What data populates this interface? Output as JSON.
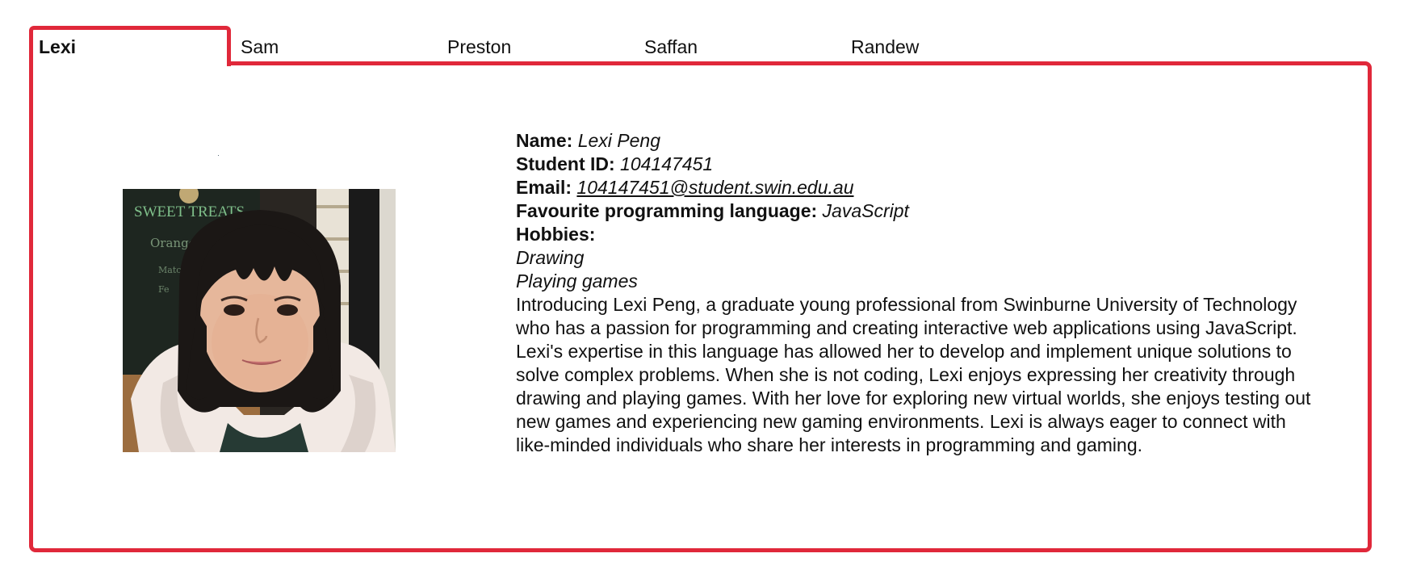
{
  "tabs": [
    {
      "label": "Lexi",
      "active": true
    },
    {
      "label": "Sam",
      "active": false
    },
    {
      "label": "Preston",
      "active": false
    },
    {
      "label": "Saffan",
      "active": false
    },
    {
      "label": "Randew",
      "active": false
    }
  ],
  "colors": {
    "accent_border": "#e0283a",
    "text": "#111111",
    "background": "#ffffff"
  },
  "profile": {
    "name_label": "Name:",
    "name_value": "Lexi Peng",
    "student_id_label": "Student ID:",
    "student_id_value": "104147451",
    "email_label": "Email:",
    "email_value": "104147451@student.swin.edu.au",
    "language_label": "Favourite programming language:",
    "language_value": "JavaScript",
    "hobbies_label": "Hobbies:",
    "hobbies": [
      "Drawing",
      "Playing games"
    ],
    "bio": "Introducing Lexi Peng, a graduate young professional from Swinburne University of Technology who has a passion for programming and creating interactive web applications using JavaScript. Lexi's expertise in this language has allowed her to develop and implement unique solutions to solve complex problems. When she is not coding, Lexi enjoys expressing her creativity through drawing and playing games. With her love for exploring new virtual worlds, she enjoys testing out new games and experiencing new gaming environments. Lexi is always eager to connect with like-minded individuals who share her interests in programming and gaming."
  },
  "photo": {
    "sign_text": "SWEET TREATS"
  }
}
